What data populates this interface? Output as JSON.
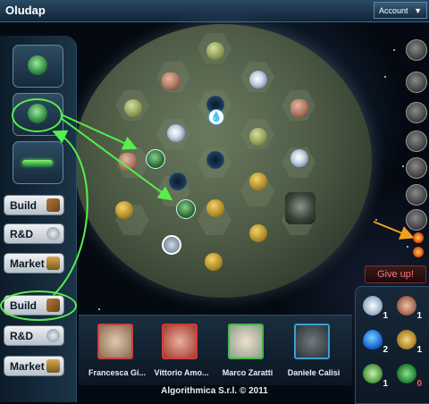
{
  "app": {
    "title": "Oludap"
  },
  "header": {
    "account_label": "Account",
    "account_arrow": "▼"
  },
  "left_panel": {
    "slots": [
      {
        "icon": "meteor-icon"
      },
      {
        "icon": "unit-icon"
      },
      {
        "icon": "energy-bar-icon"
      }
    ],
    "actions_top": {
      "build": "Build",
      "rnd": "R&D",
      "market": "Market"
    },
    "actions_bottom": {
      "build": "Build",
      "rnd": "R&D",
      "market": "Market"
    }
  },
  "board": {
    "drop_symbol": "💧"
  },
  "right_panel": {
    "give_up": "Give up!"
  },
  "resources": [
    {
      "name": "storm",
      "count": "1"
    },
    {
      "name": "meat",
      "count": "1"
    },
    {
      "name": "water",
      "count": "2"
    },
    {
      "name": "wheat",
      "count": "1"
    },
    {
      "name": "crystal",
      "count": "1"
    },
    {
      "name": "recycle",
      "count": "0"
    }
  ],
  "players": [
    {
      "name": "Francesca Gi...",
      "frame_color": "#c94040"
    },
    {
      "name": "Vittorio Amo...",
      "frame_color": "#d63a3a"
    },
    {
      "name": "Marco Zaratti",
      "frame_color": "#4ab54a"
    },
    {
      "name": "Daniele Calisi",
      "frame_color": "#3aa0d0"
    }
  ],
  "footer": {
    "copyright": "Algorithmica S.r.l. © 2011"
  },
  "colors": {
    "highlight": "#55f04a",
    "accent_arrow": "#f0a020",
    "give_up": "#ff7a7a"
  }
}
